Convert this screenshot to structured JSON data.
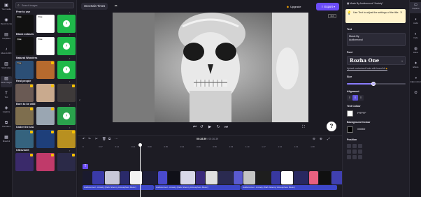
{
  "left_rail": {
    "items": [
      {
        "icon": "film-icon",
        "glyph": "▣",
        "label": "Your media"
      },
      {
        "icon": "record-icon",
        "glyph": "◉",
        "label": "Record & create"
      },
      {
        "icon": "templates-icon",
        "glyph": "▤",
        "label": "Templates"
      },
      {
        "icon": "music-icon",
        "glyph": "♪",
        "label": "Music & SFX"
      },
      {
        "icon": "video-library-icon",
        "glyph": "▥",
        "label": "Stock video"
      },
      {
        "icon": "image-icon",
        "glyph": "▨",
        "label": "Stock images"
      },
      {
        "icon": "text-icon",
        "glyph": "T",
        "label": "Text"
      },
      {
        "icon": "graphics-icon",
        "glyph": "◈",
        "label": "Graphics"
      },
      {
        "icon": "transitions-icon",
        "glyph": "⧉",
        "label": "Transitions"
      },
      {
        "icon": "brand-kit-icon",
        "glyph": "▦",
        "label": "Brand kit"
      }
    ],
    "active_index": 5
  },
  "panel": {
    "search_placeholder": "Search images",
    "sections": [
      {
        "title": "Free to use",
        "tiles": [
          {
            "tag": "Free",
            "bg": "#111111",
            "tag_style": "dark"
          },
          {
            "tag": "Free",
            "bg": "#ffffff",
            "tag_style": "light"
          },
          {
            "more": true,
            "bg": "#1fb84a"
          }
        ]
      },
      {
        "title": "Block colours",
        "tiles": [
          {
            "tag": "Free",
            "bg": "#111111",
            "tag_style": "dark"
          },
          {
            "tag": "Free",
            "bg": "#ffffff",
            "tag_style": "light"
          },
          {
            "more": true,
            "bg": "#1fb84a"
          }
        ]
      },
      {
        "title": "Natural Wonders",
        "tiles": [
          {
            "tag": "Free",
            "bg": "#2c4f76",
            "tag_style": "dark"
          },
          {
            "badge": true,
            "bg": "#b66a2e"
          },
          {
            "more": true,
            "bg": "#1fb84a"
          }
        ]
      },
      {
        "title": "Real people",
        "tiles": [
          {
            "badge": true,
            "bg": "#6a5a54"
          },
          {
            "badge": true,
            "bg": "#c9aa8e"
          },
          {
            "badge": true,
            "bg": "#3e3a3a"
          }
        ]
      },
      {
        "title": "Born to be wild",
        "tiles": [
          {
            "badge": true,
            "bg": "#7e6e4e"
          },
          {
            "badge": true,
            "bg": "#9aa6b2"
          },
          {
            "more": true,
            "bg": "#2aa24c"
          }
        ]
      },
      {
        "title": "Under the sea",
        "tiles": [
          {
            "badge": true,
            "bg": "#35637e"
          },
          {
            "badge": true,
            "bg": "#1e3f7a"
          },
          {
            "badge": true,
            "bg": "#b89020"
          }
        ]
      },
      {
        "title": "Ultraviolet",
        "tiles": [
          {
            "badge": true,
            "bg": "#3a2a6a"
          },
          {
            "badge": true,
            "bg": "#c03a6a"
          },
          {
            "badge": true,
            "bg": "#2b2a48"
          }
        ]
      }
    ]
  },
  "topbar": {
    "project_title": "Uncertain Times",
    "upgrade_label": "Upgrade",
    "export_label": "Export",
    "aspect_label": "16:9"
  },
  "timeline": {
    "timecode_current": "00:28.59",
    "timecode_total": "00:36.39",
    "ruler_ticks": [
      "0",
      "0:07",
      "0:14",
      "0:21",
      "0:28",
      "0:35",
      "0:42",
      "0:49",
      "0:56",
      "1:03",
      "1:10",
      "1:17",
      "1:24",
      "1:31",
      "1:38"
    ],
    "audio_clips": [
      {
        "label": "Audionnovul - Anxiety (Dark Gloomy Atmosphere Music)"
      },
      {
        "label": "Audionnovul - Anxiety (Dark Gloomy Atmosphere Music)"
      },
      {
        "label": "Audionnovul - Anxiety (Dark Gloomy Atmosphere Music)"
      }
    ],
    "playhead_fraction": 0.27
  },
  "right_panel": {
    "header": "Music By Audionnovul \"Anxiety\"",
    "tip_text": "Use Text to adjust the settings of the title.",
    "text_label": "Text",
    "text_lines": [
      "Music By",
      "Audionnovul"
    ],
    "font_label": "Font",
    "font_name": "Rozha One",
    "upload_link": "Upload customized fonts with brand kit",
    "size_label": "Size",
    "size_fraction": 0.45,
    "alignment_label": "Alignment",
    "text_colour_label": "Text Colour",
    "text_colour_value": "FFFFFF",
    "text_colour": "#ffffff",
    "bg_colour_label": "Background Colour",
    "bg_colour_value": "000000",
    "bg_colour": "#000000",
    "position_label": "Position"
  },
  "right_tabs": [
    {
      "icon": "captions-icon",
      "glyph": "▭",
      "label": "Captions"
    },
    {
      "icon": "audio-icon",
      "glyph": "◖",
      "label": "Audio"
    },
    {
      "icon": "fade-icon",
      "glyph": "◐",
      "label": "Fade"
    },
    {
      "icon": "filters-icon",
      "glyph": "◍",
      "label": "Filters"
    },
    {
      "icon": "effects-icon",
      "glyph": "✦",
      "label": "Effects"
    },
    {
      "icon": "adjust-colours-icon",
      "glyph": "◑",
      "label": "Adjust colours"
    },
    {
      "icon": "speed-icon",
      "glyph": "⏲",
      "label": ""
    }
  ]
}
